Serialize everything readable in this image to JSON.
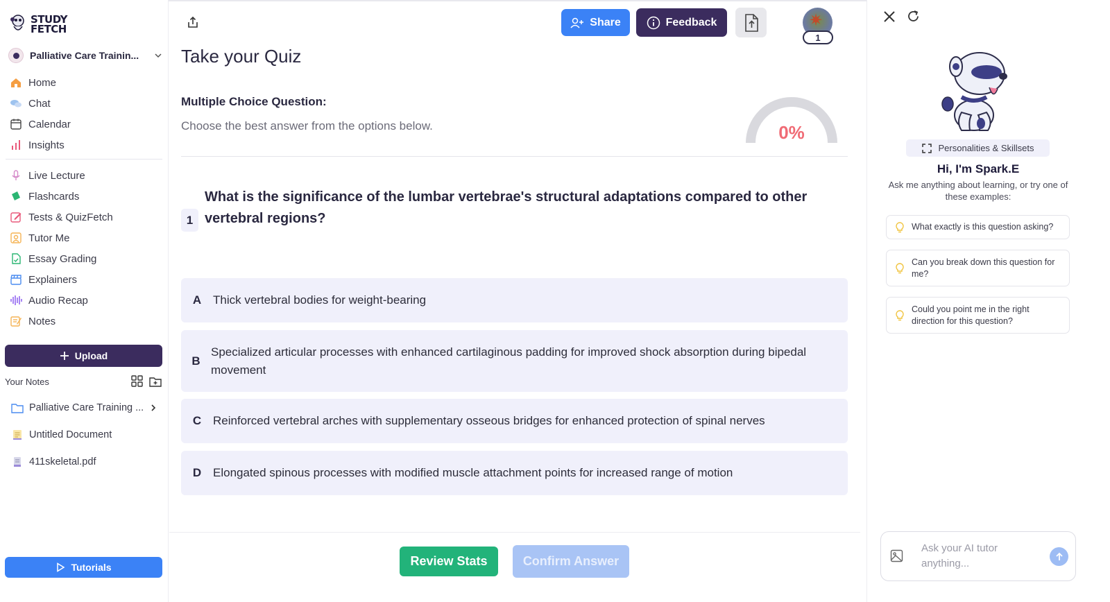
{
  "brand": {
    "name_line1": "STUDY",
    "name_line2": "FETCH"
  },
  "sidebar": {
    "course": "Palliative Care Trainin...",
    "nav_primary": [
      {
        "label": "Home",
        "icon": "home-icon"
      },
      {
        "label": "Chat",
        "icon": "chat-icon"
      },
      {
        "label": "Calendar",
        "icon": "calendar-icon"
      },
      {
        "label": "Insights",
        "icon": "insights-icon"
      }
    ],
    "nav_tools": [
      {
        "label": "Live Lecture",
        "icon": "microphone-icon"
      },
      {
        "label": "Flashcards",
        "icon": "flashcards-icon"
      },
      {
        "label": "Tests & QuizFetch",
        "icon": "pencil-icon"
      },
      {
        "label": "Tutor Me",
        "icon": "tutor-icon"
      },
      {
        "label": "Essay Grading",
        "icon": "essay-icon"
      },
      {
        "label": "Explainers",
        "icon": "clapperboard-icon"
      },
      {
        "label": "Audio Recap",
        "icon": "audio-wave-icon"
      },
      {
        "label": "Notes",
        "icon": "notes-icon"
      }
    ],
    "upload_label": "Upload",
    "your_notes_label": "Your Notes",
    "notes": [
      {
        "label": "Palliative Care Training ...",
        "icon": "folder-icon"
      },
      {
        "label": "Untitled Document",
        "icon": "document-icon"
      },
      {
        "label": "411skeletal.pdf",
        "icon": "pdf-icon"
      }
    ],
    "tutorials_label": "Tutorials"
  },
  "header": {
    "share_label": "Share",
    "feedback_label": "Feedback",
    "notification_count": "1"
  },
  "quiz": {
    "title": "Take your Quiz",
    "type_label": "Multiple Choice Question:",
    "instruction": "Choose the best answer from the options below.",
    "score": "0%",
    "score_fraction": 0,
    "question_number": "1",
    "question": "What is the significance of the lumbar vertebrae's structural adaptations compared to other vertebral regions?",
    "options": [
      {
        "letter": "A",
        "text": "Thick vertebral bodies for weight-bearing"
      },
      {
        "letter": "B",
        "text": "Specialized articular processes with enhanced cartilaginous padding for improved shock absorption during bipedal movement"
      },
      {
        "letter": "C",
        "text": "Reinforced vertebral arches with supplementary osseous bridges for enhanced protection of spinal nerves"
      },
      {
        "letter": "D",
        "text": "Elongated spinous processes with modified muscle attachment points for increased range of motion"
      }
    ],
    "review_label": "Review Stats",
    "confirm_label": "Confirm Answer"
  },
  "assistant": {
    "personalities_label": "Personalities & Skillsets",
    "greeting": "Hi, I'm Spark.E",
    "intro": "Ask me anything about learning, or try one of these examples:",
    "suggestions": [
      "What exactly is this question asking?",
      "Can you break down this question for me?",
      "Could you point me in the right direction for this question?"
    ],
    "input_placeholder": "Ask your AI tutor anything..."
  },
  "colors": {
    "accent_blue": "#3b82f6",
    "brand_purple": "#3b2c5e",
    "success_green": "#22b37a",
    "score_red": "#f06b75",
    "option_bg": "#f0f0fb"
  }
}
